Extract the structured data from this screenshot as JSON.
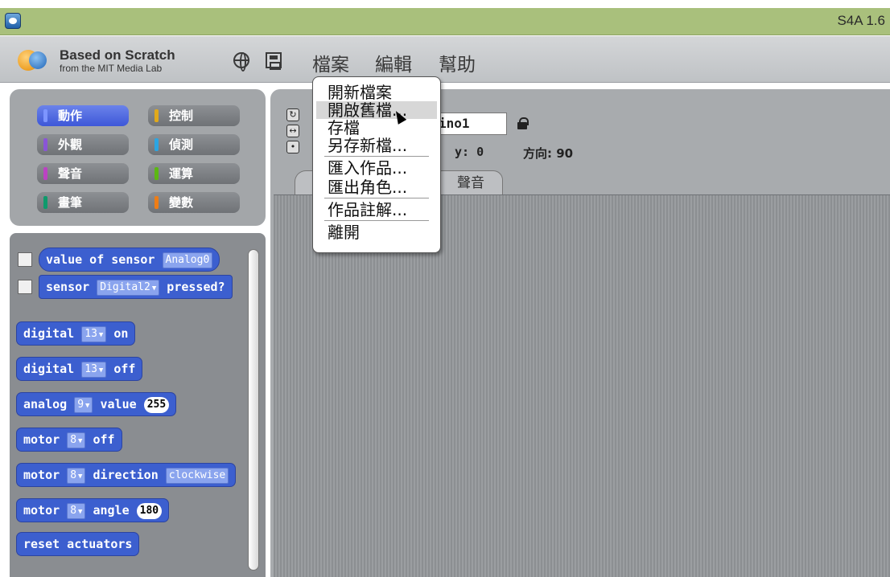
{
  "window": {
    "title": "S4A 1.6"
  },
  "brand": {
    "title": "Based on Scratch",
    "subtitle": "from the MIT Media Lab"
  },
  "menu": {
    "file": "檔案",
    "edit": "編輯",
    "help": "幫助"
  },
  "categories": [
    {
      "label": "動作",
      "color": "#4a6cd4"
    },
    {
      "label": "控制",
      "color": "#e1a91a"
    },
    {
      "label": "外觀",
      "color": "#8a55d7"
    },
    {
      "label": "偵測",
      "color": "#2ca5e2"
    },
    {
      "label": "聲音",
      "color": "#bb42c3"
    },
    {
      "label": "運算",
      "color": "#5cb712"
    },
    {
      "label": "畫筆",
      "color": "#0e9a6c"
    },
    {
      "label": "變數",
      "color": "#ee7d16"
    }
  ],
  "blocks": {
    "sensor_value": {
      "text": "value of sensor",
      "arg": "Analog0"
    },
    "sensor_pressed": {
      "text": "sensor",
      "arg": "Digital2",
      "suffix": "pressed?"
    },
    "digital_on": {
      "text": "digital",
      "arg": "13",
      "suffix": "on"
    },
    "digital_off": {
      "text": "digital",
      "arg": "13",
      "suffix": "off"
    },
    "analog_value": {
      "text": "analog",
      "arg": "9",
      "mid": "value",
      "num": "255"
    },
    "motor_off": {
      "text": "motor",
      "arg": "8",
      "suffix": "off"
    },
    "motor_direction": {
      "text": "motor",
      "arg": "8",
      "mid": "direction",
      "arg2": "clockwise"
    },
    "motor_angle": {
      "text": "motor",
      "arg": "8",
      "mid": "angle",
      "num": "180"
    },
    "reset": {
      "text": "reset actuators"
    }
  },
  "sprite": {
    "name": "ino1",
    "y": "y: 0",
    "direction": "方向: 90"
  },
  "tabs": {
    "sound": "聲音"
  },
  "file_menu": {
    "items": [
      "開新檔案",
      "開啟舊檔...",
      "存檔",
      "另存新檔...",
      "匯入作品...",
      "匯出角色...",
      "作品註解...",
      "離開"
    ]
  }
}
